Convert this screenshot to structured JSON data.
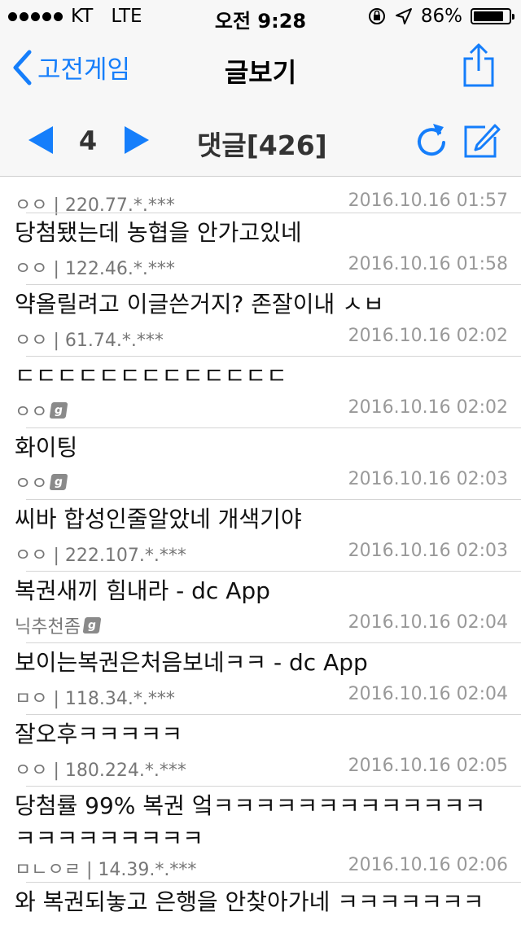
{
  "status_bar": {
    "carrier": "KT",
    "network": "LTE",
    "time": "오전 9:28",
    "battery": "86%",
    "battery_level": 0.86
  },
  "nav": {
    "back_label": "고전게임",
    "title": "글보기",
    "share_icon": "share-icon"
  },
  "toolbar": {
    "page": "4",
    "comments_title": "댓글[426]",
    "prev_icon": "triangle-left-icon",
    "next_icon": "triangle-right-icon",
    "refresh_icon": "refresh-icon",
    "compose_icon": "compose-icon"
  },
  "comments": [
    {
      "text": "",
      "author": "ㅇㅇ | 220.77.*.***",
      "date": "2016.10.16 01:57",
      "badge": false
    },
    {
      "text": "당첨됐는데 농협을 안가고있네",
      "author": "ㅇㅇ | 122.46.*.***",
      "date": "2016.10.16 01:58",
      "badge": false
    },
    {
      "text": "약올릴려고 이글쓴거지? 존잘이내 ㅅㅂ",
      "author": "ㅇㅇ | 61.74.*.***",
      "date": "2016.10.16 02:02",
      "badge": false
    },
    {
      "text": "ㄷㄷㄷㄷㄷㄷㄷㄷㄷㄷㄷㄷㄷ",
      "author": "ㅇㅇ",
      "date": "2016.10.16 02:02",
      "badge": true
    },
    {
      "text": "화이팅",
      "author": "ㅇㅇ",
      "date": "2016.10.16 02:03",
      "badge": true
    },
    {
      "text": "씨바 합성인줄알았네 개색기야",
      "author": "ㅇㅇ | 222.107.*.***",
      "date": "2016.10.16 02:03",
      "badge": false
    },
    {
      "text": "복권새끼 힘내라  - dc App",
      "author": "닉추천좀",
      "date": "2016.10.16 02:04",
      "badge": true
    },
    {
      "text": "보이는복권은처음보네ㅋㅋ  - dc App",
      "author": "ㅁㅇ | 118.34.*.***",
      "date": "2016.10.16 02:04",
      "badge": false
    },
    {
      "text": "잘오후ㅋㅋㅋㅋㅋ",
      "author": "ㅇㅇ | 180.224.*.***",
      "date": "2016.10.16 02:05",
      "badge": false
    },
    {
      "text": "당첨률 99% 복권 엌ㅋㅋㅋㅋㅋㅋㅋㅋㅋㅋㅋㅋㅋㅋㅋㅋㅋㅋㅋㅋㅋㅋ",
      "author": "ㅁㄴㅇㄹ | 14.39.*.***",
      "date": "2016.10.16 02:06",
      "badge": false
    },
    {
      "text": "와 복권되놓고 은행을 안찾아가네 ㅋㅋㅋㅋㅋㅋㅋㅋㅋ",
      "author": "",
      "date": "",
      "badge": false
    }
  ],
  "colors": {
    "accent": "#157efb",
    "bar_bg": "#f7f7f7",
    "separator": "#d5d5d5"
  }
}
